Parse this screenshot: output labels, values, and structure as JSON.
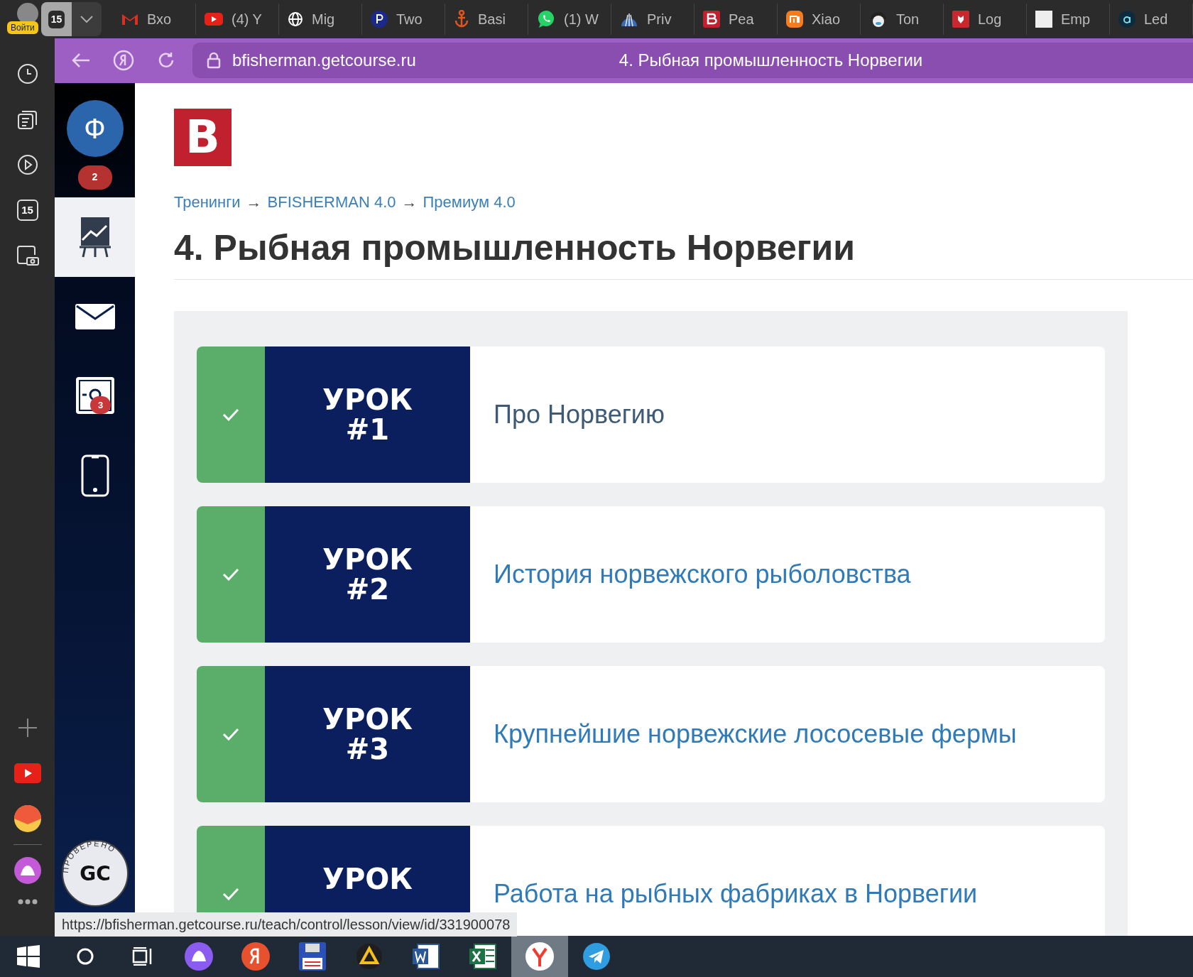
{
  "browser": {
    "profile_label": "Войти",
    "tab_count": "15",
    "tabs": [
      {
        "kind": "gmail",
        "label": "Вхо",
        "selected": false
      },
      {
        "kind": "youtube",
        "label": "(4) Y",
        "selected": false
      },
      {
        "kind": "globe",
        "label": "Mig",
        "selected": false
      },
      {
        "kind": "p",
        "label": "Two",
        "selected": false
      },
      {
        "kind": "anchor",
        "label": "Basi",
        "selected": false
      },
      {
        "kind": "whatsapp",
        "label": "(1) W",
        "selected": false
      },
      {
        "kind": "shell",
        "label": "Priv",
        "selected": false
      },
      {
        "kind": "b",
        "label": "Pea",
        "selected": false
      },
      {
        "kind": "mi",
        "label": "Xiao",
        "selected": false
      },
      {
        "kind": "face",
        "label": "Ton",
        "selected": false
      },
      {
        "kind": "crest",
        "label": "Log",
        "selected": false
      },
      {
        "kind": "blank",
        "label": "Emp",
        "selected": false
      },
      {
        "kind": "a",
        "label": "Led",
        "selected": false
      }
    ]
  },
  "address_bar": {
    "url": "bfisherman.getcourse.ru",
    "page_title": "4. Рыбная промышленность Норвегии"
  },
  "browser_sidebar": {
    "calendar_day": "15"
  },
  "school_sidebar": {
    "avatar_letter": "Ф",
    "notifications_badge": "2",
    "stamp_ring": "ПРОВЕРЕНО",
    "stamp_letters": "GC",
    "items": [
      {
        "kind": "chart",
        "selected": true
      },
      {
        "kind": "mail",
        "selected": false
      },
      {
        "kind": "safe",
        "selected": false,
        "badge": "3"
      },
      {
        "kind": "phone",
        "selected": false
      }
    ]
  },
  "logo_letter": "B",
  "breadcrumbs": [
    {
      "kind": "link",
      "label": "Тренинги"
    },
    {
      "kind": "separator",
      "label": "→"
    },
    {
      "kind": "link",
      "label": "BFISHERMAN 4.0"
    },
    {
      "kind": "separator",
      "label": "→"
    },
    {
      "kind": "link",
      "label": "Премиум 4.0"
    }
  ],
  "title": "4. Рыбная промышленность Норвегии",
  "lessons": [
    {
      "badge_word": "УРОК",
      "number": "#1",
      "title": "Про Норвегию",
      "completed": true,
      "highlighted": true
    },
    {
      "badge_word": "УРОК",
      "number": "#2",
      "title": "История норвежского рыболовства",
      "completed": true,
      "highlighted": false
    },
    {
      "badge_word": "УРОК",
      "number": "#3",
      "title": "Крупнейшие норвежские лососевые фермы",
      "completed": true,
      "highlighted": false
    },
    {
      "badge_word": "УРОК",
      "title": "Работа на рыбных фабриках в Норвегии",
      "completed": true,
      "highlighted": false
    }
  ],
  "status_url": "https://bfisherman.getcourse.ru/teach/control/lesson/view/id/331900078",
  "taskbar": [
    {
      "kind": "start",
      "selected": false
    },
    {
      "kind": "search",
      "selected": false
    },
    {
      "kind": "taskview",
      "selected": false
    },
    {
      "kind": "alice",
      "selected": false
    },
    {
      "kind": "ya",
      "selected": false
    },
    {
      "kind": "floppy",
      "selected": false
    },
    {
      "kind": "triangle",
      "selected": false
    },
    {
      "kind": "word",
      "selected": false
    },
    {
      "kind": "excel",
      "selected": false
    },
    {
      "kind": "ybrowser",
      "selected": true
    },
    {
      "kind": "telegram",
      "selected": false
    }
  ]
}
